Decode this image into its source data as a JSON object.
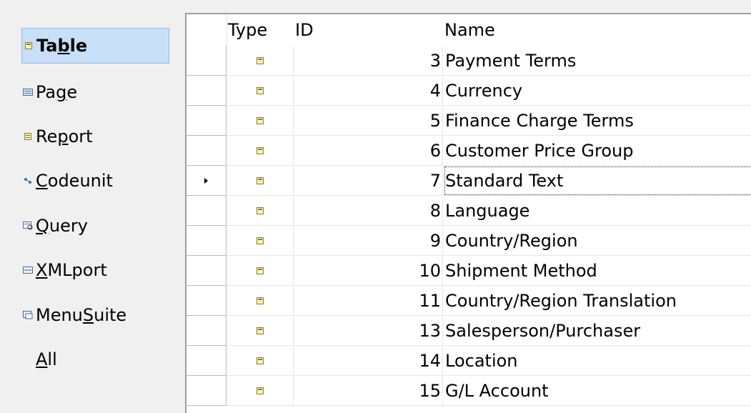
{
  "nav": {
    "items": [
      {
        "pre": "Ta",
        "ul": "b",
        "post": "le",
        "icon": "table-icon",
        "selected": true
      },
      {
        "pre": "Pa",
        "ul": "g",
        "post": "e",
        "icon": "page-icon",
        "selected": false
      },
      {
        "pre": "Re",
        "ul": "p",
        "post": "ort",
        "icon": "report-icon",
        "selected": false
      },
      {
        "pre": "",
        "ul": "C",
        "post": "odeunit",
        "icon": "codeunit-icon",
        "selected": false
      },
      {
        "pre": "",
        "ul": "Q",
        "post": "uery",
        "icon": "query-icon",
        "selected": false
      },
      {
        "pre": "",
        "ul": "X",
        "post": "MLport",
        "icon": "xmlport-icon",
        "selected": false
      },
      {
        "pre": "Menu",
        "ul": "S",
        "post": "uite",
        "icon": "menusuite-icon",
        "selected": false
      },
      {
        "pre": "",
        "ul": "A",
        "post": "ll",
        "icon": "",
        "selected": false
      }
    ]
  },
  "grid": {
    "columns": {
      "type": "Type",
      "id": "ID",
      "name": "Name"
    },
    "rows": [
      {
        "id": "3",
        "name": "Payment Terms",
        "current": false
      },
      {
        "id": "4",
        "name": "Currency",
        "current": false
      },
      {
        "id": "5",
        "name": "Finance Charge Terms",
        "current": false
      },
      {
        "id": "6",
        "name": "Customer Price Group",
        "current": false
      },
      {
        "id": "7",
        "name": "Standard Text",
        "current": true
      },
      {
        "id": "8",
        "name": "Language",
        "current": false
      },
      {
        "id": "9",
        "name": "Country/Region",
        "current": false
      },
      {
        "id": "10",
        "name": "Shipment Method",
        "current": false
      },
      {
        "id": "11",
        "name": "Country/Region Translation",
        "current": false
      },
      {
        "id": "13",
        "name": "Salesperson/Purchaser",
        "current": false
      },
      {
        "id": "14",
        "name": "Location",
        "current": false
      },
      {
        "id": "15",
        "name": "G/L Account",
        "current": false
      }
    ]
  }
}
